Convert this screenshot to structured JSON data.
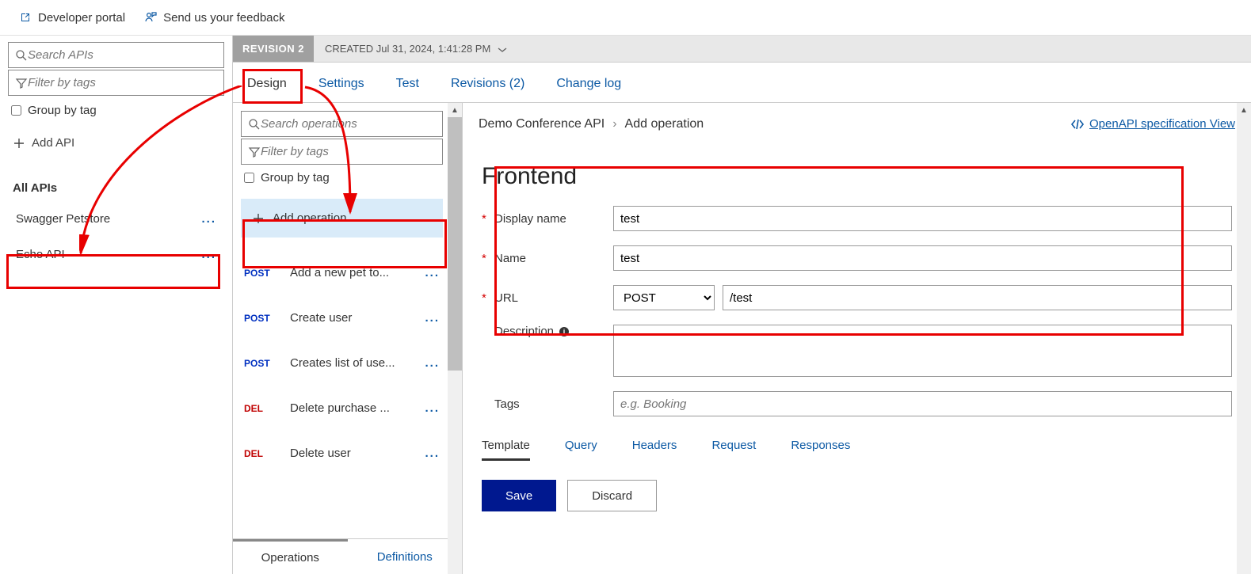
{
  "topbar": {
    "dev_portal": "Developer portal",
    "feedback": "Send us your feedback"
  },
  "left": {
    "search_placeholder": "Search APIs",
    "filter_placeholder": "Filter by tags",
    "group_by_tag": "Group by tag",
    "add_api": "Add API",
    "all_apis_label": "All APIs",
    "apis": [
      {
        "name": "Swagger Petstore"
      },
      {
        "name": "Echo API"
      }
    ]
  },
  "revision": {
    "badge": "REVISION 2",
    "created_label": "CREATED",
    "created_ts": "Jul 31, 2024, 1:41:28 PM"
  },
  "tabs": {
    "design": "Design",
    "settings": "Settings",
    "test": "Test",
    "revisions": "Revisions (2)",
    "changelog": "Change log"
  },
  "ops": {
    "search_placeholder": "Search operations",
    "filter_placeholder": "Filter by tags",
    "group_by_tag": "Group by tag",
    "add_operation": "Add operation",
    "bottom_tabs": {
      "operations": "Operations",
      "definitions": "Definitions"
    },
    "items": [
      {
        "method": "POST",
        "name": "Add a new pet to..."
      },
      {
        "method": "POST",
        "name": "Create user"
      },
      {
        "method": "POST",
        "name": "Creates list of use..."
      },
      {
        "method": "DEL",
        "name": "Delete purchase ..."
      },
      {
        "method": "DEL",
        "name": "Delete user"
      }
    ]
  },
  "breadcrumb": {
    "api": "Demo Conference API",
    "page": "Add operation"
  },
  "openapi_link": "OpenAPI specification View",
  "frontend": {
    "title": "Frontend",
    "labels": {
      "display_name": "Display name",
      "name": "Name",
      "url": "URL",
      "description": "Description",
      "tags": "Tags"
    },
    "values": {
      "display_name": "test",
      "name": "test",
      "method": "POST",
      "url_path": "/test"
    },
    "tags_placeholder": "e.g. Booking",
    "sub_tabs": {
      "template": "Template",
      "query": "Query",
      "headers": "Headers",
      "request": "Request",
      "responses": "Responses"
    },
    "buttons": {
      "save": "Save",
      "discard": "Discard"
    }
  }
}
